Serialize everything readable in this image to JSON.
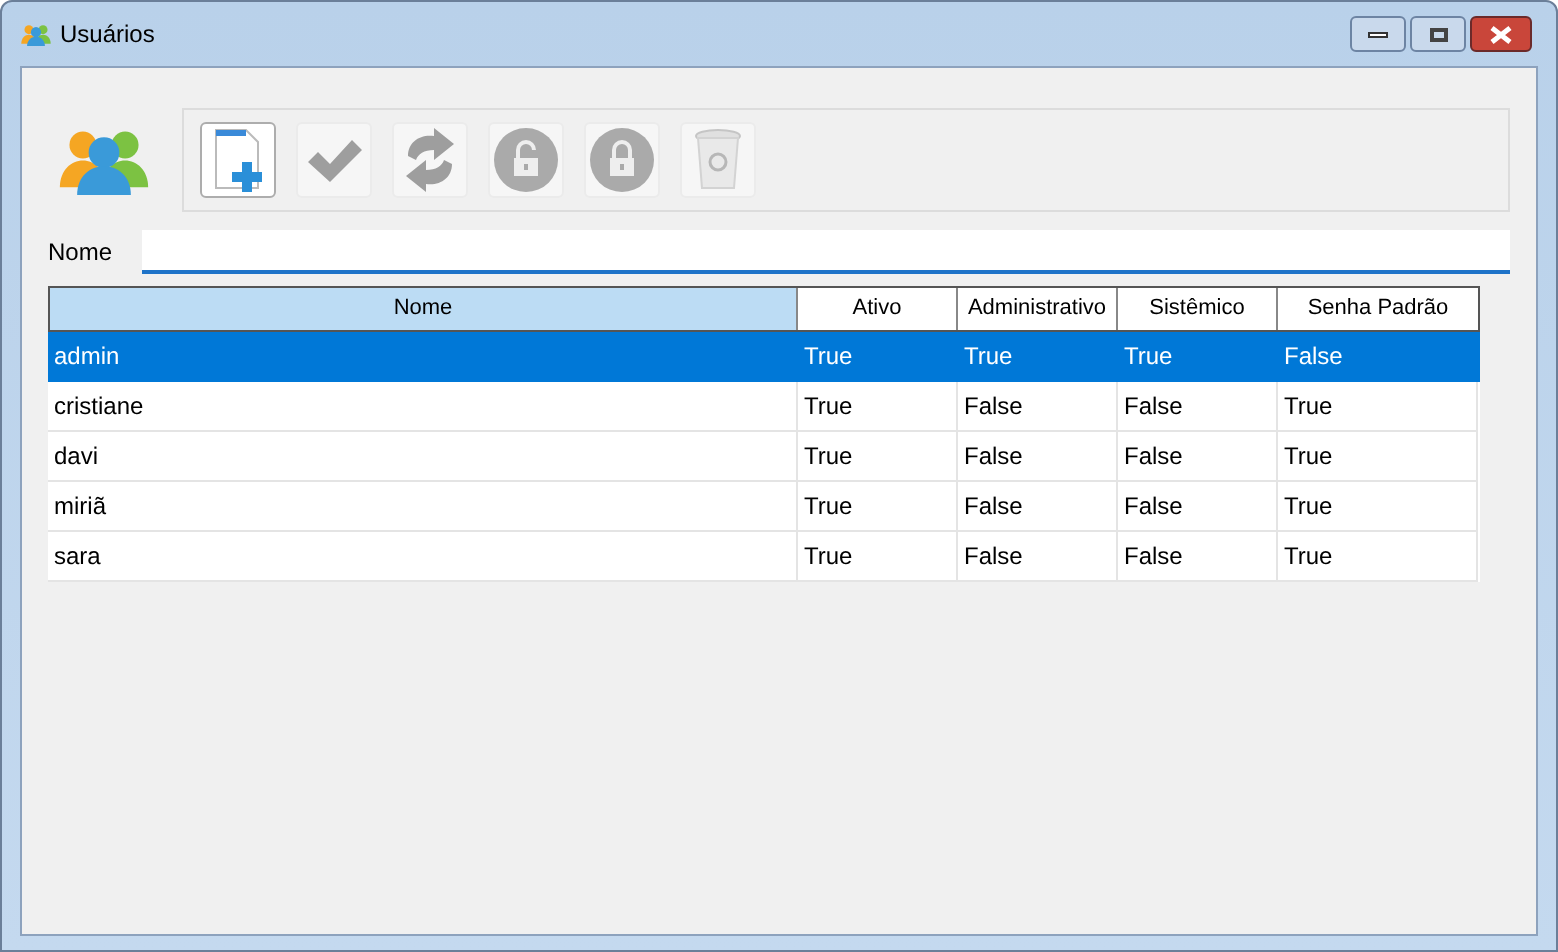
{
  "window": {
    "title": "Usuários"
  },
  "toolbar": [
    {
      "kind": "new",
      "disabled": false
    },
    {
      "kind": "check",
      "disabled": true
    },
    {
      "kind": "refresh",
      "disabled": true
    },
    {
      "kind": "unlock",
      "disabled": true
    },
    {
      "kind": "lock",
      "disabled": true
    },
    {
      "kind": "trash",
      "disabled": true
    }
  ],
  "filter": {
    "label": "Nome"
  },
  "table": {
    "columns": [
      {
        "label": "Nome",
        "selected": true
      },
      {
        "label": "Ativo",
        "selected": false
      },
      {
        "label": "Administrativo",
        "selected": false
      },
      {
        "label": "Sistêmico",
        "selected": false
      },
      {
        "label": "Senha Padrão",
        "selected": false
      }
    ],
    "rows": [
      {
        "selected": true,
        "cells": [
          "admin",
          "True",
          "True",
          "True",
          "False"
        ]
      },
      {
        "selected": false,
        "cells": [
          "cristiane",
          "True",
          "False",
          "False",
          "True"
        ]
      },
      {
        "selected": false,
        "cells": [
          "davi",
          "True",
          "False",
          "False",
          "True"
        ]
      },
      {
        "selected": false,
        "cells": [
          "miriã",
          "True",
          "False",
          "False",
          "True"
        ]
      },
      {
        "selected": false,
        "cells": [
          "sara",
          "True",
          "False",
          "False",
          "True"
        ]
      }
    ]
  }
}
